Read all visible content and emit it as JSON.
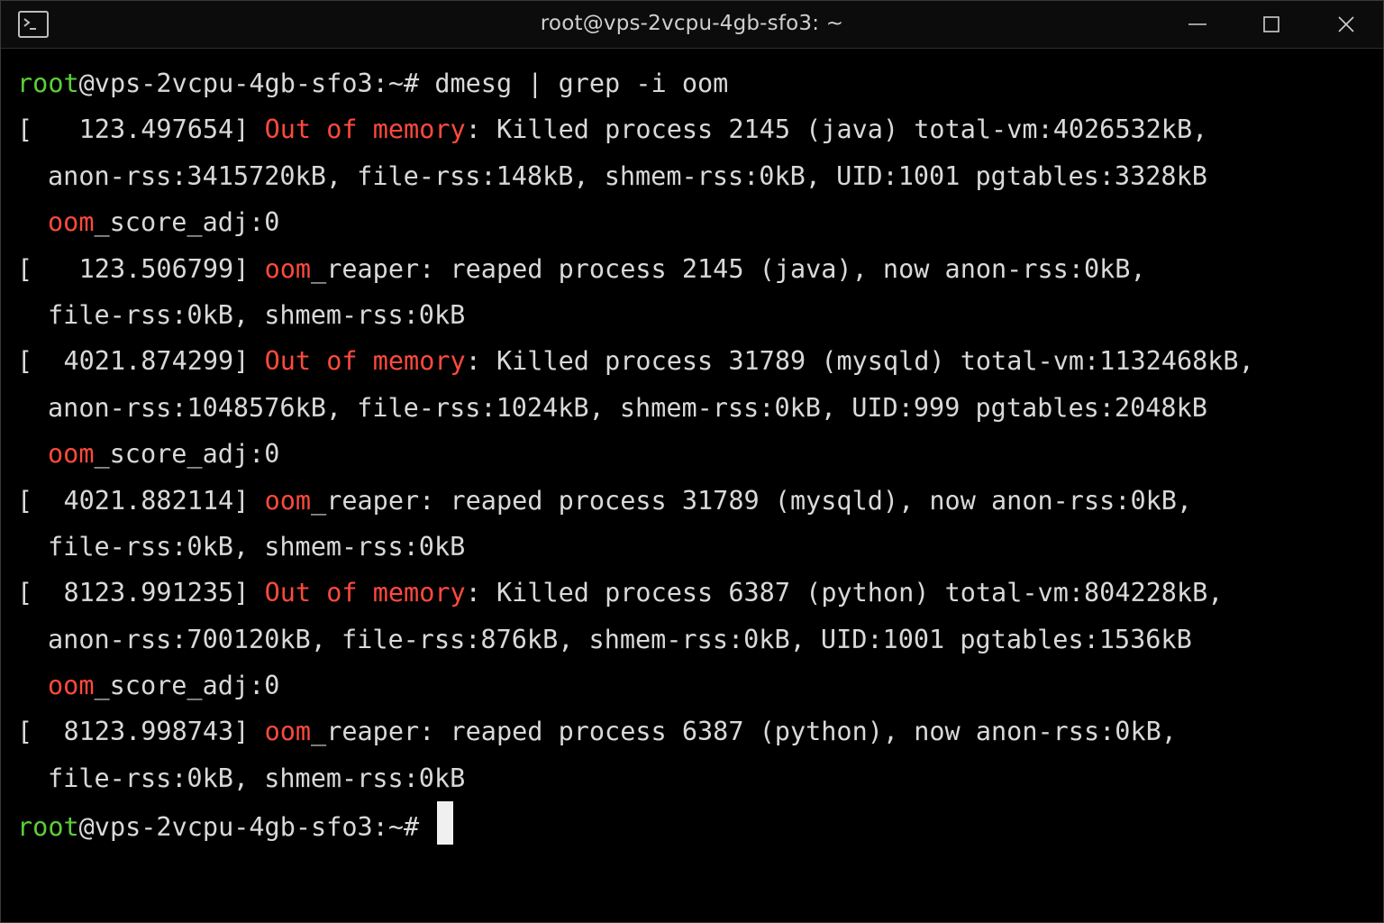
{
  "window": {
    "title": "root@vps-2vcpu-4gb-sfo3: ~",
    "icons": {
      "app": "terminal-icon",
      "minimize": "minimize-icon",
      "maximize": "maximize-icon",
      "close": "close-icon"
    }
  },
  "colors": {
    "background": "#000000",
    "text": "#d9d9d9",
    "prompt_user": "#5ccf3a",
    "highlight": "#ff4a3d",
    "cursor": "#f0f0f0"
  },
  "prompt": {
    "user": "root",
    "host_path": "@vps-2vcpu-4gb-sfo3:",
    "tilde": "~",
    "symbol": "#"
  },
  "command": " dmesg | grep -i oom",
  "log": [
    {
      "ts": "[   123.497654]",
      "tag1": "Out",
      "tag2": "of",
      "tag3": "memory",
      "rest": ": Killed process 2145 (java) total-vm:4026532kB,",
      "cont1": "anon-rss:3415720kB, file-rss:148kB, shmem-rss:0kB, UID:1001 pgtables:3328kB",
      "cont2_tag": "oom",
      "cont2_rest": "_score_adj:0"
    },
    {
      "ts": "[   123.506799]",
      "tag": "oom",
      "rest": "_reaper: reaped process 2145 (java), now anon-rss:0kB,",
      "cont": "file-rss:0kB, shmem-rss:0kB"
    },
    {
      "ts": "[  4021.874299]",
      "tag1": "Out",
      "tag2": "of",
      "tag3": "memory",
      "rest": ": Killed process 31789 (mysqld) total-vm:1132468kB,",
      "cont1": "anon-rss:1048576kB, file-rss:1024kB, shmem-rss:0kB, UID:999 pgtables:2048kB",
      "cont2_tag": "oom",
      "cont2_rest": "_score_adj:0"
    },
    {
      "ts": "[  4021.882114]",
      "tag": "oom",
      "rest": "_reaper: reaped process 31789 (mysqld), now anon-rss:0kB,",
      "cont": "file-rss:0kB, shmem-rss:0kB"
    },
    {
      "ts": "[  8123.991235]",
      "tag1": "Out",
      "tag2": "of",
      "tag3": "memory",
      "rest": ": Killed process 6387 (python) total-vm:804228kB,",
      "cont1": "anon-rss:700120kB, file-rss:876kB, shmem-rss:0kB, UID:1001 pgtables:1536kB",
      "cont2_tag": "oom",
      "cont2_rest": "_score_adj:0"
    },
    {
      "ts": "[  8123.998743]",
      "tag": "oom",
      "rest": "_reaper: reaped process 6387 (python), now anon-rss:0kB,",
      "cont": "file-rss:0kB, shmem-rss:0kB"
    }
  ]
}
